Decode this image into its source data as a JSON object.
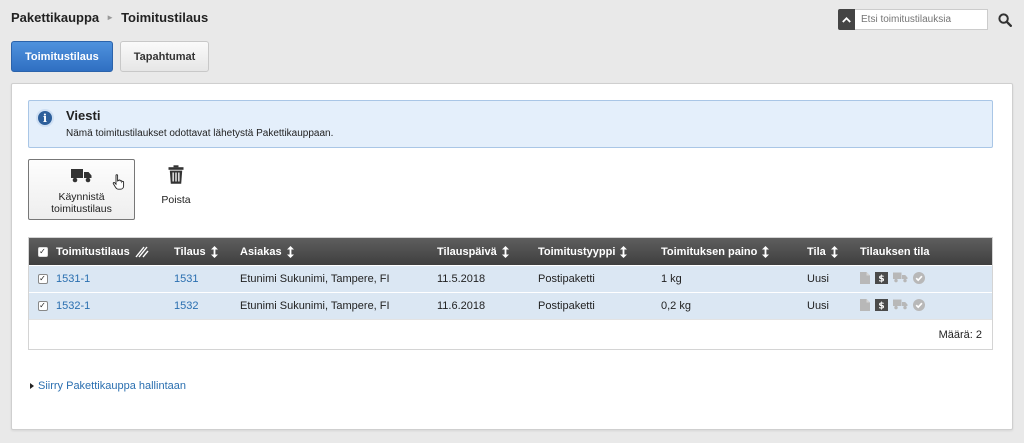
{
  "breadcrumb": {
    "items": [
      "Pakettikauppa",
      "Toimitustilaus"
    ]
  },
  "search": {
    "placeholder": "Etsi toimitustilauksia",
    "value": ""
  },
  "tabs": [
    {
      "label": "Toimitustilaus",
      "active": true
    },
    {
      "label": "Tapahtumat",
      "active": false
    }
  ],
  "message": {
    "title": "Viesti",
    "text": "Nämä toimitustilaukset odottavat lähetystä Pakettikauppaan."
  },
  "actions": {
    "start_label_1": "Käynnistä",
    "start_label_2": "toimitustilaus",
    "delete_label": "Poista"
  },
  "table": {
    "headers": {
      "toimitustilaus": "Toimitustilaus",
      "tilaus": "Tilaus",
      "asiakas": "Asiakas",
      "tilauspaiva": "Tilauspäivä",
      "toimitustyyppi": "Toimitustyyppi",
      "paino": "Toimituksen paino",
      "tila": "Tila",
      "tilauksen_tila": "Tilauksen tila"
    },
    "rows": [
      {
        "checked": true,
        "toimitustilaus": "1531-1",
        "tilaus": "1531",
        "asiakas": "Etunimi Sukunimi, Tampere, FI",
        "tilauspaiva": "11.5.2018",
        "toimitustyyppi": "Postipaketti",
        "paino": "1 kg",
        "tila": "Uusi"
      },
      {
        "checked": true,
        "toimitustilaus": "1532-1",
        "tilaus": "1532",
        "asiakas": "Etunimi Sukunimi, Tampere, FI",
        "tilauspaiva": "11.6.2018",
        "toimitustyyppi": "Postipaketti",
        "paino": "0,2 kg",
        "tila": "Uusi"
      }
    ],
    "footer": "Määrä: 2"
  },
  "nav_link": "Siirry Pakettikauppa hallintaan",
  "colors": {
    "accent": "#3a7fd0",
    "row_bg": "#dbe7f3",
    "header_bg": "#4a4a4a",
    "message_bg": "#e4effb",
    "link": "#2a6fb0"
  },
  "icons": {
    "status": [
      "document-icon",
      "invoice-icon",
      "truck-icon",
      "check-circle-icon"
    ]
  }
}
